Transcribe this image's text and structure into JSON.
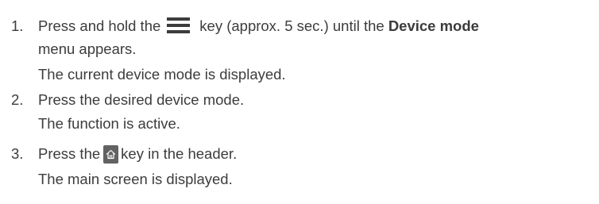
{
  "steps": [
    {
      "number": "1.",
      "line1_before": "Press and hold the",
      "line1_middle": "key (approx. 5 sec.) until the",
      "line1_bold": "Device mode",
      "line2": "menu appears.",
      "result": "The current device mode is displayed.",
      "icon": "menu-hamburger-icon"
    },
    {
      "number": "2.",
      "line1": "Press the desired device mode.",
      "result": "The function is active."
    },
    {
      "number": "3.",
      "line1_before": "Press the",
      "line1_after": "key in the header.",
      "result": "The main screen is displayed.",
      "icon": "home-icon"
    }
  ],
  "colors": {
    "text": "#3c3c3c",
    "icon_dark": "#3c3c3c",
    "home_key_bg": "#626262",
    "home_key_glyph": "#ffffff"
  }
}
